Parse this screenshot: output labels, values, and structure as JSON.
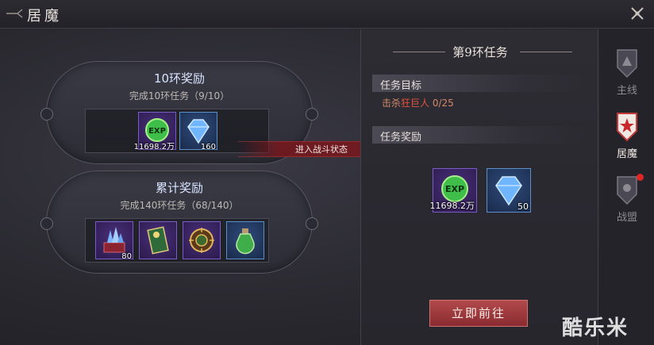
{
  "window": {
    "title": "居魔"
  },
  "left": {
    "ring_reward": {
      "title": "10环奖励",
      "subtitle": "完成10环任务（9/10）",
      "items": [
        {
          "icon": "exp-orb-icon",
          "count": "11698.2万"
        },
        {
          "icon": "diamond-icon",
          "count": "160"
        }
      ]
    },
    "cumulative_reward": {
      "title": "累计奖励",
      "subtitle": "完成140环任务（68/140）",
      "items": [
        {
          "icon": "crystal-chest-icon",
          "count": "80"
        },
        {
          "icon": "scroll-card-icon",
          "count": ""
        },
        {
          "icon": "compass-medal-icon",
          "count": ""
        },
        {
          "icon": "potion-bottle-icon",
          "count": ""
        }
      ]
    }
  },
  "banner": {
    "text": "进入战斗状态"
  },
  "right": {
    "task_title": "第9环任务",
    "goal_label": "任务目标",
    "goal": {
      "prefix": "击杀",
      "target": "狂巨人",
      "progress": "0/25"
    },
    "reward_label": "任务奖励",
    "rewards": [
      {
        "icon": "exp-orb-icon",
        "count": "11698.2万"
      },
      {
        "icon": "diamond-icon",
        "count": "50"
      }
    ],
    "go_button": "立即前往"
  },
  "tabs": [
    {
      "label": "主线",
      "active": false
    },
    {
      "label": "居魔",
      "active": true
    },
    {
      "label": "战盟",
      "active": false,
      "badge": true
    }
  ],
  "watermark": "酷乐米",
  "colors": {
    "accent_red": "#b1494b",
    "target_red": "#e0523d",
    "item_purple": "#7b5bc6",
    "item_blue": "#5c8fc9"
  }
}
